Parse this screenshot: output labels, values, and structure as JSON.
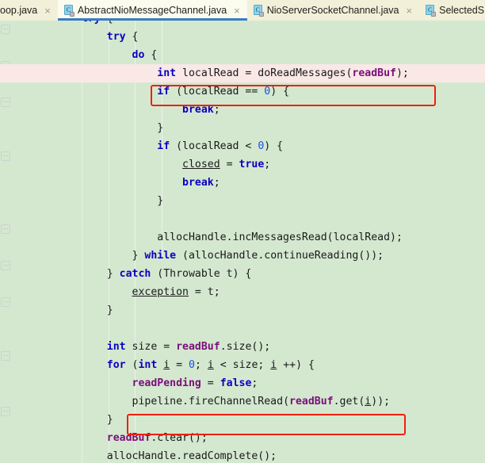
{
  "window": {
    "app": "IntelliJ IDEA Editor",
    "file_icon_letter": "C"
  },
  "tabs": [
    {
      "label": "oop.java",
      "icon": "java-class-icon",
      "close": "×",
      "active": false,
      "truncated": true
    },
    {
      "label": "AbstractNioMessageChannel.java",
      "icon": "java-class-icon",
      "close": "×",
      "active": true,
      "truncated": false
    },
    {
      "label": "NioServerSocketChannel.java",
      "icon": "java-class-icon",
      "close": "×",
      "active": false,
      "truncated": false
    },
    {
      "label": "SelectedS",
      "icon": "java-class-icon",
      "close": "",
      "active": false,
      "truncated": true
    }
  ],
  "editor": {
    "language": "java",
    "background_color": "#d4e8d0",
    "caret_line_color": "#f9e8e6",
    "annotation_color": "#f21f0f",
    "keyword_color": "#0c00c0",
    "field_color": "#7a0f7a",
    "number_color": "#1750eb",
    "lines": [
      {
        "indent": 0,
        "clipped": true,
        "tokens": [
          {
            "t": "try",
            "c": "kw"
          },
          {
            "t": " {",
            "c": "pl"
          }
        ]
      },
      {
        "indent": 4,
        "tokens": [
          {
            "t": "try",
            "c": "kw"
          },
          {
            "t": " {",
            "c": "pl"
          }
        ]
      },
      {
        "indent": 8,
        "tokens": [
          {
            "t": "do",
            "c": "kw"
          },
          {
            "t": " {",
            "c": "pl"
          }
        ]
      },
      {
        "indent": 12,
        "caret": true,
        "boxed": 1,
        "tokens": [
          {
            "t": "int",
            "c": "kw"
          },
          {
            "t": " localRead = doReadMessages(",
            "c": "pl"
          },
          {
            "t": "readBuf",
            "c": "fld"
          },
          {
            "t": ");",
            "c": "pl"
          }
        ]
      },
      {
        "indent": 12,
        "tokens": [
          {
            "t": "if",
            "c": "kw"
          },
          {
            "t": " (localRead == ",
            "c": "pl"
          },
          {
            "t": "0",
            "c": "num"
          },
          {
            "t": ") {",
            "c": "pl"
          }
        ]
      },
      {
        "indent": 16,
        "tokens": [
          {
            "t": "break",
            "c": "kw"
          },
          {
            "t": ";",
            "c": "pl"
          }
        ]
      },
      {
        "indent": 12,
        "tokens": [
          {
            "t": "}",
            "c": "pl"
          }
        ]
      },
      {
        "indent": 12,
        "tokens": [
          {
            "t": "if",
            "c": "kw"
          },
          {
            "t": " (localRead < ",
            "c": "pl"
          },
          {
            "t": "0",
            "c": "num"
          },
          {
            "t": ") {",
            "c": "pl"
          }
        ]
      },
      {
        "indent": 16,
        "tokens": [
          {
            "t": "closed",
            "c": "und"
          },
          {
            "t": " = ",
            "c": "pl"
          },
          {
            "t": "true",
            "c": "kw"
          },
          {
            "t": ";",
            "c": "pl"
          }
        ]
      },
      {
        "indent": 16,
        "tokens": [
          {
            "t": "break",
            "c": "kw"
          },
          {
            "t": ";",
            "c": "pl"
          }
        ]
      },
      {
        "indent": 12,
        "tokens": [
          {
            "t": "}",
            "c": "pl"
          }
        ]
      },
      {
        "indent": 0,
        "tokens": [
          {
            "t": "",
            "c": "pl"
          }
        ]
      },
      {
        "indent": 12,
        "tokens": [
          {
            "t": "allocHandle.incMessagesRead(localRead);",
            "c": "pl"
          }
        ]
      },
      {
        "indent": 8,
        "tokens": [
          {
            "t": "} ",
            "c": "pl"
          },
          {
            "t": "while",
            "c": "kw"
          },
          {
            "t": " (allocHandle.continueReading());",
            "c": "pl"
          }
        ]
      },
      {
        "indent": 4,
        "tokens": [
          {
            "t": "} ",
            "c": "pl"
          },
          {
            "t": "catch",
            "c": "kw"
          },
          {
            "t": " (Throwable t) {",
            "c": "pl"
          }
        ]
      },
      {
        "indent": 8,
        "tokens": [
          {
            "t": "exception",
            "c": "und"
          },
          {
            "t": " = t;",
            "c": "pl"
          }
        ]
      },
      {
        "indent": 4,
        "tokens": [
          {
            "t": "}",
            "c": "pl"
          }
        ]
      },
      {
        "indent": 0,
        "tokens": [
          {
            "t": "",
            "c": "pl"
          }
        ]
      },
      {
        "indent": 4,
        "tokens": [
          {
            "t": "int",
            "c": "kw"
          },
          {
            "t": " size = ",
            "c": "pl"
          },
          {
            "t": "readBuf",
            "c": "fld"
          },
          {
            "t": ".size();",
            "c": "pl"
          }
        ]
      },
      {
        "indent": 4,
        "tokens": [
          {
            "t": "for",
            "c": "kw"
          },
          {
            "t": " (",
            "c": "pl"
          },
          {
            "t": "int",
            "c": "kw"
          },
          {
            "t": " ",
            "c": "pl"
          },
          {
            "t": "i",
            "c": "und"
          },
          {
            "t": " = ",
            "c": "pl"
          },
          {
            "t": "0",
            "c": "num"
          },
          {
            "t": "; ",
            "c": "pl"
          },
          {
            "t": "i",
            "c": "und"
          },
          {
            "t": " < size; ",
            "c": "pl"
          },
          {
            "t": "i",
            "c": "und"
          },
          {
            "t": " ++) {",
            "c": "pl"
          }
        ]
      },
      {
        "indent": 8,
        "tokens": [
          {
            "t": "readPending",
            "c": "fld"
          },
          {
            "t": " = ",
            "c": "pl"
          },
          {
            "t": "false",
            "c": "kw"
          },
          {
            "t": ";",
            "c": "pl"
          }
        ]
      },
      {
        "indent": 8,
        "boxed": 2,
        "tokens": [
          {
            "t": "pipeline.fireChannelRead(",
            "c": "pl"
          },
          {
            "t": "readBuf",
            "c": "fld"
          },
          {
            "t": ".get(",
            "c": "pl"
          },
          {
            "t": "i",
            "c": "und"
          },
          {
            "t": "));",
            "c": "pl"
          }
        ]
      },
      {
        "indent": 4,
        "tokens": [
          {
            "t": "}",
            "c": "pl"
          }
        ]
      },
      {
        "indent": 4,
        "tokens": [
          {
            "t": "readBuf",
            "c": "fld"
          },
          {
            "t": ".clear();",
            "c": "pl"
          }
        ]
      },
      {
        "indent": 4,
        "clipped_bottom": true,
        "tokens": [
          {
            "t": "allocHandle.readComplete();",
            "c": "pl"
          }
        ]
      }
    ],
    "annotations": [
      {
        "id": 1,
        "name": "red-highlight-box-doReadMessages"
      },
      {
        "id": 2,
        "name": "red-highlight-box-fireChannelRead"
      }
    ]
  }
}
